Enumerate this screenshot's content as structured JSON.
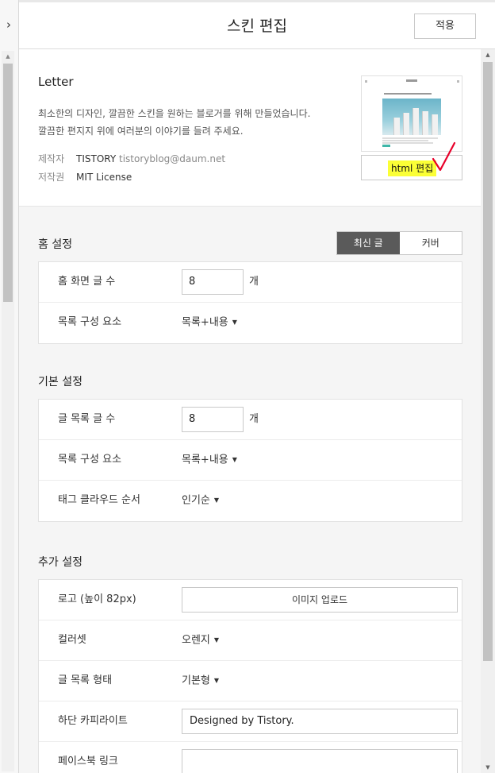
{
  "header": {
    "title": "스킨 편집",
    "apply_label": "적용"
  },
  "sidebar": {
    "toggle_icon": "chevron-right-icon"
  },
  "skin": {
    "name": "Letter",
    "description_line1": "최소한의 디자인, 깔끔한 스킨을 원하는 블로거를 위해 만들었습니다.",
    "description_line2": "깔끔한 편지지 위에 여러분의 이야기를 들려 주세요.",
    "maker_label": "제작자",
    "maker_name": "TISTORY",
    "maker_email": "tistoryblog@daum.net",
    "license_label": "저작권",
    "license_value": "MIT License",
    "html_edit_label": "html 편집",
    "highlight_color": "#fbff36",
    "annotation_color": "#e8002a"
  },
  "home_settings": {
    "title": "홈 설정",
    "tabs": [
      {
        "label": "최신 글",
        "active": true
      },
      {
        "label": "커버",
        "active": false
      }
    ],
    "rows": {
      "post_count_label": "홈 화면 글 수",
      "post_count_value": "8",
      "post_count_unit": "개",
      "list_element_label": "목록 구성 요소",
      "list_element_value": "목록+내용"
    }
  },
  "basic_settings": {
    "title": "기본 설정",
    "rows": {
      "post_count_label": "글 목록 글 수",
      "post_count_value": "8",
      "post_count_unit": "개",
      "list_element_label": "목록 구성 요소",
      "list_element_value": "목록+내용",
      "tag_order_label": "태그 클라우드 순서",
      "tag_order_value": "인기순"
    }
  },
  "extra_settings": {
    "title": "추가 설정",
    "rows": {
      "logo_label": "로고 (높이 82px)",
      "logo_button": "이미지 업로드",
      "colorset_label": "컬러셋",
      "colorset_value": "오렌지",
      "list_style_label": "글 목록 형태",
      "list_style_value": "기본형",
      "copyright_label": "하단 카피라이트",
      "copyright_value": "Designed by Tistory.",
      "facebook_label": "페이스북 링크",
      "facebook_value": ""
    }
  }
}
